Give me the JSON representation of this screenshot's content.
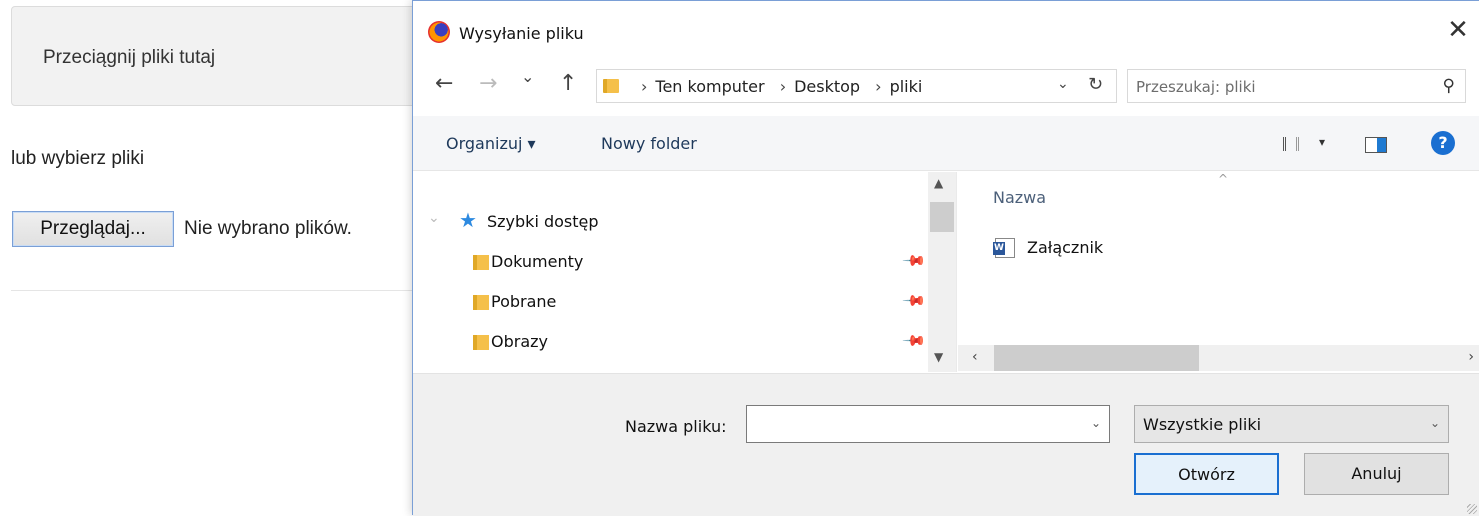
{
  "page": {
    "drop_zone_text": "Przeciągnij pliki tutaj",
    "or_text": "lub wybierz pliki",
    "browse_button": "Przeglądaj...",
    "no_files": "Nie wybrano plików."
  },
  "dialog": {
    "title": "Wysyłanie pliku",
    "close": "✕",
    "nav": {
      "back": "←",
      "forward": "→",
      "recent": "⌄",
      "up": "↑"
    },
    "address": {
      "sep": "›",
      "crumbs": [
        "Ten komputer",
        "Desktop",
        "pliki"
      ],
      "dropdown": "⌄",
      "refresh": "↻"
    },
    "search": {
      "placeholder": "Przeszukaj: pliki",
      "icon": "search-icon"
    },
    "toolbar": {
      "organize": "Organizuj ▾",
      "new_folder": "Nowy folder",
      "view_caret": "▾",
      "help": "?"
    },
    "nav_pane": {
      "quick_access": "Szybki dostęp",
      "items": [
        {
          "label": "Dokumenty",
          "icon": "documents-folder-icon",
          "pinned": true
        },
        {
          "label": "Pobrane",
          "icon": "downloads-folder-icon",
          "pinned": true
        },
        {
          "label": "Obrazy",
          "icon": "pictures-folder-icon",
          "pinned": true
        }
      ]
    },
    "file_pane": {
      "column_name": "Nazwa",
      "files": [
        {
          "name": "Załącznik",
          "icon": "word-document-icon"
        }
      ]
    },
    "bottom": {
      "filename_label": "Nazwa pliku:",
      "filename_value": "",
      "filetype_value": "Wszystkie pliki",
      "open_button": "Otwórz",
      "cancel_button": "Anuluj"
    }
  },
  "colors": {
    "accent": "#1a6fd1",
    "folder": "#f5c04a",
    "toolbar_bg": "#f5f6f8",
    "bottom_bg": "#f0f0f0"
  }
}
